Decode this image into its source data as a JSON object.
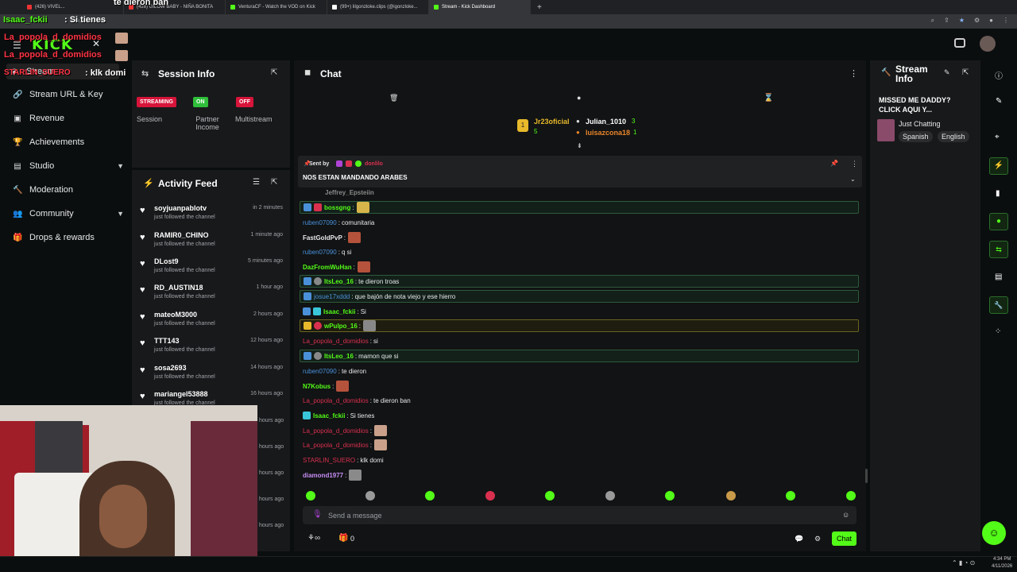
{
  "browser": {
    "tabs": [
      {
        "title": "(426) VIVEL..."
      },
      {
        "title": "(426) GILOW BABY - NIÑA BONITA"
      },
      {
        "title": "VenturaCF - Watch the VOD on Kick"
      },
      {
        "title": "(99+) lilgonzloke.clips (@igonzloke..."
      },
      {
        "title": "Stream - Kick Dashboard"
      }
    ],
    "url": "kick.com/stream",
    "time": "4:34 PM",
    "date": "4/11/2026"
  },
  "overlay": {
    "top_msg": "te dieron ban",
    "l1_user": "Isaac_fckii",
    "l1_text": ": Si tienes",
    "l2_user": "La_popola_d_domidios",
    "l3_user": "La_popola_d_domidios",
    "l4_user": "STARLIN_SUERO",
    "l4_text": ": klk domi"
  },
  "nav": {
    "logo": "KICK",
    "items": [
      {
        "label": "Stream"
      },
      {
        "label": "Stream URL & Key"
      },
      {
        "label": "Revenue"
      },
      {
        "label": "Achievements"
      },
      {
        "label": "Studio"
      },
      {
        "label": "Moderation"
      },
      {
        "label": "Community"
      },
      {
        "label": "Drops & rewards"
      }
    ]
  },
  "session": {
    "title": "Session Info",
    "streaming": "STREAMING",
    "on": "ON",
    "off": "OFF",
    "label_session": "Session",
    "label_partner": "Partner Income",
    "label_multi": "Multistream"
  },
  "activity": {
    "title": "Activity Feed",
    "items": [
      {
        "name": "soyjuanpablotv",
        "sub": "just followed the channel",
        "time": "in 2 minutes"
      },
      {
        "name": "RAMIR0_CHINO",
        "sub": "just followed the channel",
        "time": "1 minute ago"
      },
      {
        "name": "DLost9",
        "sub": "just followed the channel",
        "time": "5 minutes ago"
      },
      {
        "name": "RD_AUSTIN18",
        "sub": "just followed the channel",
        "time": "1 hour ago"
      },
      {
        "name": "mateoM3000",
        "sub": "just followed the channel",
        "time": "2 hours ago"
      },
      {
        "name": "TTT143",
        "sub": "just followed the channel",
        "time": "12 hours ago"
      },
      {
        "name": "sosa2693",
        "sub": "just followed the channel",
        "time": "14 hours ago"
      },
      {
        "name": "mariangel53888",
        "sub": "just followed the channel",
        "time": "16 hours ago"
      }
    ],
    "extra_times": [
      "hours ago",
      "hours ago",
      "hours ago",
      "hours ago",
      "hours ago"
    ]
  },
  "chat": {
    "title": "Chat",
    "top_users": [
      {
        "name": "Jr23oficial",
        "count": "5"
      },
      {
        "name": "Julian_1010",
        "count": "3"
      },
      {
        "name": "luisazcona18",
        "count": "1"
      }
    ],
    "pinned": {
      "sent_by": "Sent by",
      "user": "donlilo",
      "message": "NOS ESTAN MANDANDO ARABES"
    },
    "partial_user": "Jeffrey_Epsteiin",
    "messages": [
      {
        "user": "bossgng",
        "text": "",
        "color": "#53fc18"
      },
      {
        "user": "ruben07090",
        "text": "comunitaria",
        "color": "#4a90d9"
      },
      {
        "user": "FastGoldPvP",
        "text": "",
        "color": "#e6e8ea"
      },
      {
        "user": "ruben07090",
        "text": "q si",
        "color": "#4a90d9"
      },
      {
        "user": "DazFromWuHan",
        "text": "",
        "color": "#53fc18"
      },
      {
        "user": "ItsLeo_16",
        "text": "te dieron troas",
        "color": "#53fc18"
      },
      {
        "user": "josue17xddd",
        "text": "que bajón de nota viejo y ese hierro",
        "color": "#4a90d9"
      },
      {
        "user": "Isaac_fckii",
        "text": "Si",
        "color": "#53fc18"
      },
      {
        "user": "wPulpo_16",
        "text": "",
        "color": "#53fc18"
      },
      {
        "user": "La_popola_d_domidios",
        "text": "si",
        "color": "#d9304f"
      },
      {
        "user": "ItsLeo_16",
        "text": "mamon que si",
        "color": "#53fc18"
      },
      {
        "user": "ruben07090",
        "text": "te dieron",
        "color": "#4a90d9"
      },
      {
        "user": "N7Kobus",
        "text": "",
        "color": "#53fc18"
      },
      {
        "user": "La_popola_d_domidios",
        "text": "te dieron ban",
        "color": "#d9304f"
      },
      {
        "user": "Isaac_fckii",
        "text": "Si tienes",
        "color": "#53fc18"
      },
      {
        "user": "La_popola_d_domidios",
        "text": "",
        "color": "#d9304f"
      },
      {
        "user": "La_popola_d_domidios",
        "text": "",
        "color": "#d9304f"
      },
      {
        "user": "STARLIN_SUERO",
        "text": "klk domi",
        "color": "#d9304f"
      },
      {
        "user": "diamond1977",
        "text": "",
        "color": "#c88ef5"
      }
    ],
    "input_placeholder": "Send a message",
    "points": "0",
    "chat_button": "Chat"
  },
  "stream_info": {
    "title": "Stream Info",
    "line1": "MISSED ME DADDY?",
    "line2": "CLICK AQUI Y...",
    "category": "Just Chatting",
    "tag1": "Spanish",
    "tag2": "English"
  }
}
